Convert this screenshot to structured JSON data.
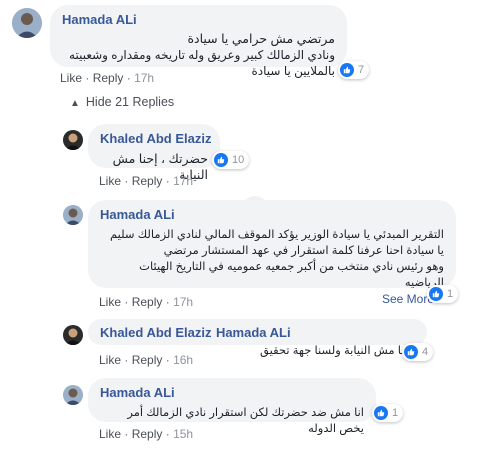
{
  "comment_main": {
    "author": "Hamada ALi",
    "lines": [
      "مرتضي مش حرامي يا سيادة",
      "ونادي الزمالك كبير وعريق وله تاريخه ومقداره وشعبيته بالملايين يا سيادة"
    ],
    "like_label": "Like",
    "reply_label": "Reply",
    "time": "17h",
    "reaction_count": "7"
  },
  "hide_replies": {
    "label": "Hide 21 Replies"
  },
  "reply_1": {
    "author": "Khaled Abd Elaziz",
    "lines": [
      "حضرتك ، إحنا مش النيابة"
    ],
    "like_label": "Like",
    "reply_label": "Reply",
    "time": "17h",
    "reaction_count": "10"
  },
  "reply_2": {
    "author": "Hamada ALi",
    "lines": [
      "التقرير المبدئي يا سيادة الوزير يؤكد الموقف المالي لنادي الزمالك سليم",
      "يا سيادة احنا عرفنا كلمة استقرار في عهد المستشار مرتضي",
      "وهو رئيس نادي منتخب من أكبر جمعيه عموميه في التاريخ الهيئات الرياضيه"
    ],
    "see_more": "See More...",
    "like_label": "Like",
    "reply_label": "Reply",
    "time": "17h",
    "reaction_count": "1"
  },
  "reply_3": {
    "author": "Khaled Abd Elaziz",
    "mention": "Hamada ALi",
    "text": "إحنا مش النيابة ولسنا جهة تحقيق",
    "like_label": "Like",
    "reply_label": "Reply",
    "time": "16h",
    "reaction_count": "4"
  },
  "reply_4": {
    "author": "Hamada ALi",
    "text": "انا مش ضد حضرتك لكن استقرار نادي الزمالك أمر يخص الدوله",
    "like_label": "Like",
    "reply_label": "Reply",
    "time": "15h",
    "reaction_count": "1"
  },
  "colors": {
    "name_link": "#385898",
    "bubble_bg": "#f2f3f5",
    "like_blue": "#1877f2",
    "meta_grey": "#90949c"
  },
  "icons": {
    "reaction": "like-thumb-icon",
    "hide_replies": "chevron-up-icon"
  }
}
